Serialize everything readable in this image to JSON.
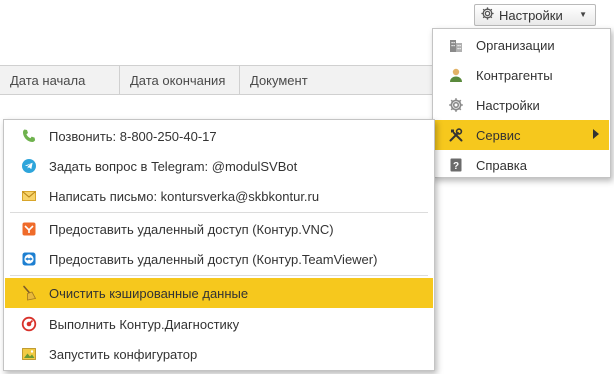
{
  "settings_button": {
    "label": "Настройки",
    "icon": "gear-icon"
  },
  "table": {
    "columns": [
      "Дата начала",
      "Дата окончания",
      "Документ"
    ]
  },
  "settings_menu": {
    "items": [
      {
        "label": "Организации",
        "icon": "buildings-icon"
      },
      {
        "label": "Контрагенты",
        "icon": "person-icon"
      },
      {
        "label": "Настройки",
        "icon": "gear-icon"
      },
      {
        "label": "Сервис",
        "icon": "tools-icon",
        "highlighted": true,
        "has_submenu": true
      },
      {
        "label": "Справка",
        "icon": "help-icon"
      }
    ]
  },
  "service_menu": {
    "items": [
      {
        "label": "Позвонить: 8-800-250-40-17",
        "icon": "phone-icon"
      },
      {
        "label": "Задать вопрос в Telegram: @modulSVBot",
        "icon": "telegram-icon"
      },
      {
        "label": "Написать письмо: kontursverka@skbkontur.ru",
        "icon": "mail-icon"
      },
      {
        "label": "Предоставить удаленный доступ (Контур.VNC)",
        "icon": "vnc-icon"
      },
      {
        "label": "Предоставить удаленный доступ (Контур.TeamViewer)",
        "icon": "teamviewer-icon"
      },
      {
        "label": "Очистить кэшированные данные",
        "icon": "broom-icon",
        "highlighted": true
      },
      {
        "label": "Выполнить Контур.Диагностику",
        "icon": "diagnostics-icon"
      },
      {
        "label": "Запустить конфигуратор",
        "icon": "configurator-icon"
      }
    ]
  },
  "colors": {
    "highlight": "#f6c81d",
    "menu_border": "#c4c4c4",
    "header_bg": "#f2f2f2"
  }
}
